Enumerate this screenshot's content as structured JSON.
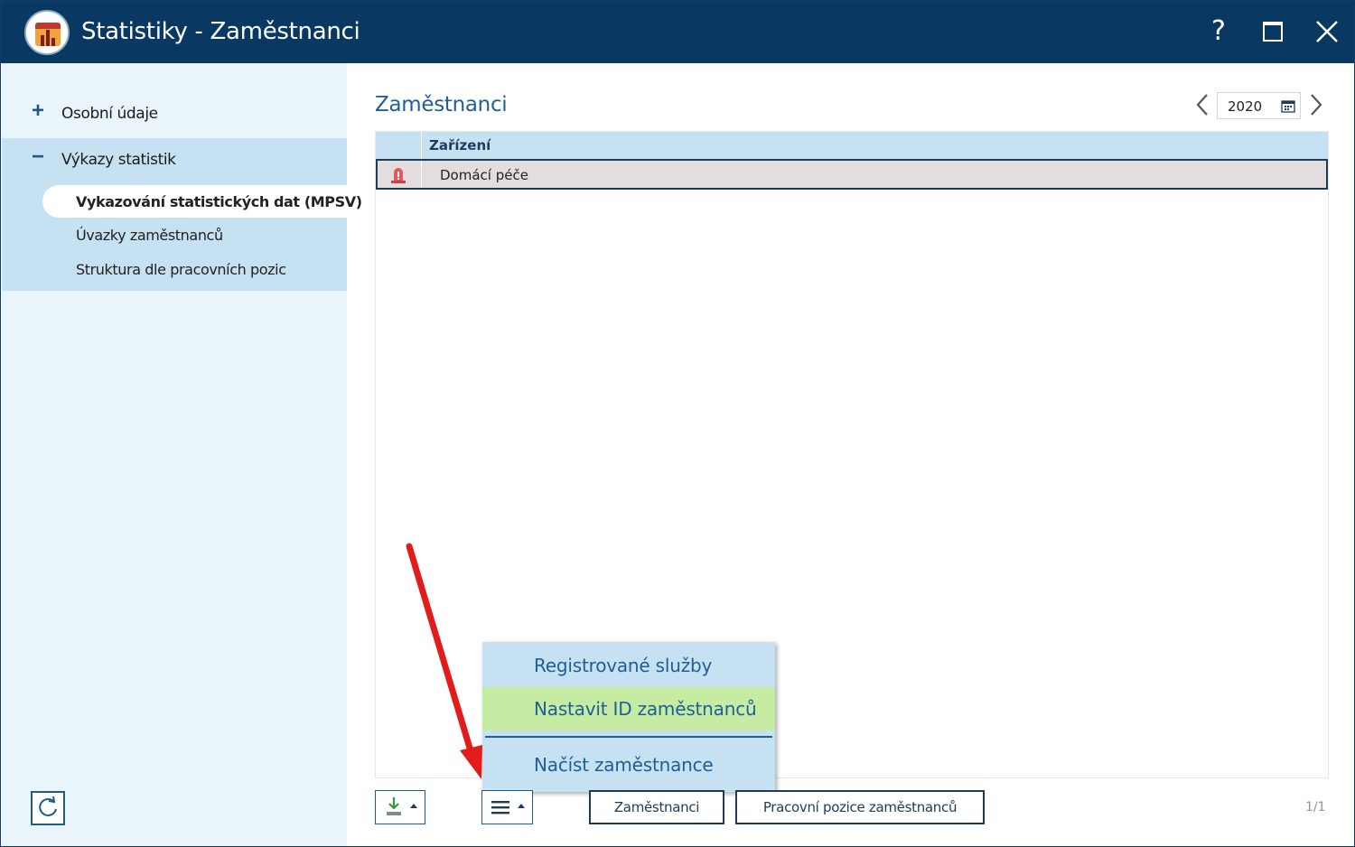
{
  "window": {
    "title": "Statistiky - Zaměstnanci",
    "help_label": "?"
  },
  "sidebar": {
    "groups": [
      {
        "toggle": "+",
        "label": "Osobní údaje",
        "expanded": false
      },
      {
        "toggle": "−",
        "label": "Výkazy statistik",
        "expanded": true
      }
    ],
    "items": [
      {
        "label": "Vykazování statistických dat (MPSV)",
        "selected": true
      },
      {
        "label": "Úvazky zaměstnanců",
        "selected": false
      },
      {
        "label": "Struktura dle pracovních pozic",
        "selected": false
      }
    ]
  },
  "main": {
    "title": "Zaměstnanci",
    "year": "2020",
    "grid": {
      "columns": [
        "Zařízení"
      ],
      "rows": [
        {
          "icon": "alarm-icon",
          "name": "Domácí péče"
        }
      ]
    }
  },
  "popup_menu": {
    "items": [
      "Registrované služby",
      "Nastavit ID zaměstnanců",
      "Načíst zaměstnance"
    ],
    "highlighted": "Nastavit ID zaměstnanců"
  },
  "bottom_bar": {
    "employees_button": "Zaměstnanci",
    "positions_button": "Pracovní pozice zaměstnanců",
    "pager": "1/1"
  },
  "colors": {
    "titlebar": "#093863",
    "sidebar_bg": "#eaf4fb",
    "sidebar_active_group": "#c6e1f2",
    "accent": "#1f5f96",
    "menu_highlight": "#c6eba2",
    "annotation_arrow": "#e31b1b"
  }
}
